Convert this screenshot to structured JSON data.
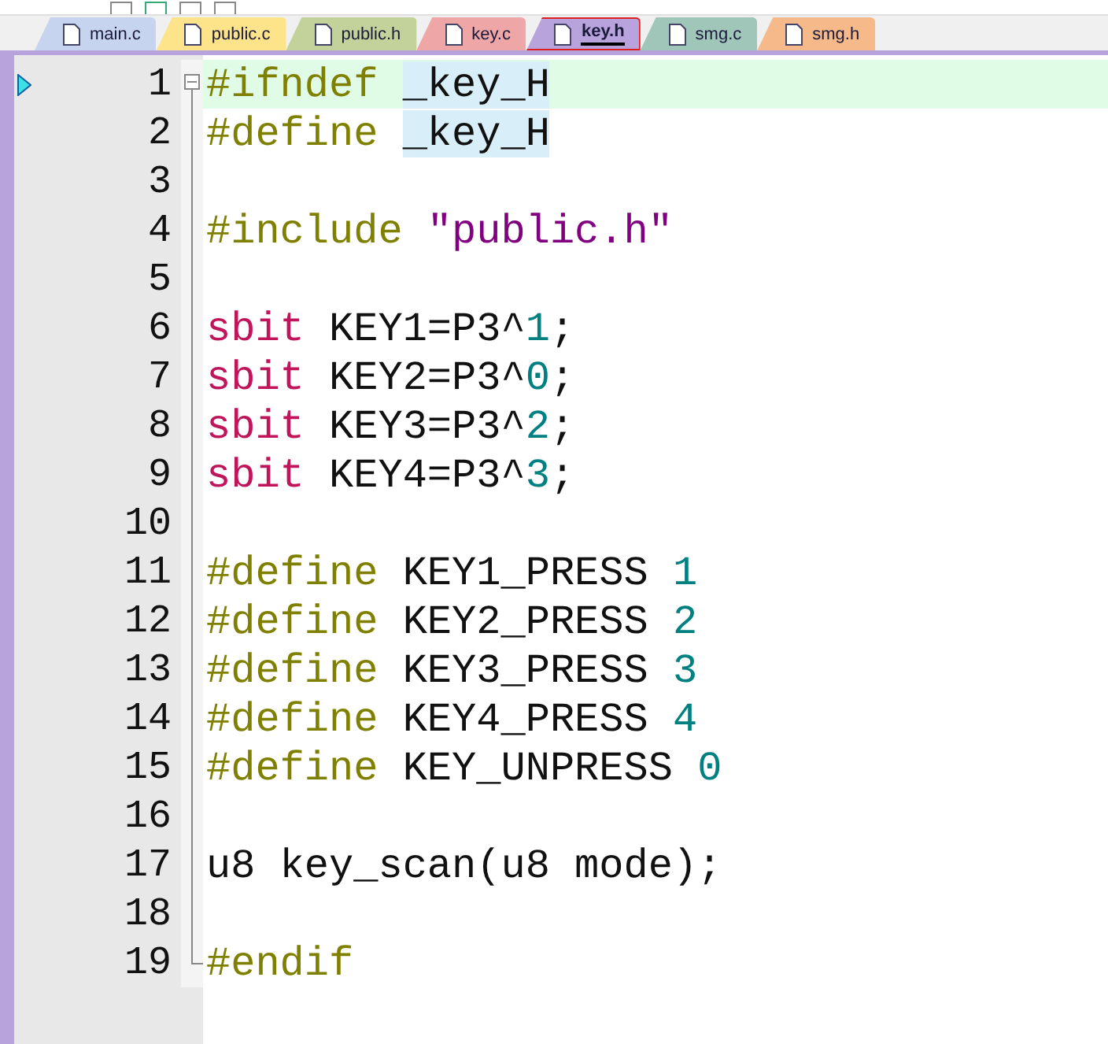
{
  "tabs": [
    {
      "label": "main.c",
      "color": "#c6d4f0",
      "selected": false
    },
    {
      "label": "public.c",
      "color": "#fde48a",
      "selected": false
    },
    {
      "label": "public.h",
      "color": "#c3d29a",
      "selected": false
    },
    {
      "label": "key.c",
      "color": "#eea6a6",
      "selected": false
    },
    {
      "label": "key.h",
      "color": "#b9a3dc",
      "selected": true
    },
    {
      "label": "smg.c",
      "color": "#9fc6b8",
      "selected": false
    },
    {
      "label": "smg.h",
      "color": "#f6b98a",
      "selected": false
    }
  ],
  "lines": [
    {
      "number": "1",
      "current": true,
      "marker": true,
      "fold_start": true,
      "tokens": [
        {
          "kind": "preproc",
          "text": "#ifndef "
        },
        {
          "kind": "ident",
          "text": "_key_H",
          "highlight": true
        }
      ]
    },
    {
      "number": "2",
      "tokens": [
        {
          "kind": "preproc",
          "text": "#define "
        },
        {
          "kind": "ident",
          "text": "_key_H",
          "highlight": true
        }
      ]
    },
    {
      "number": "3"
    },
    {
      "number": "4",
      "tokens": [
        {
          "kind": "preproc",
          "text": "#include "
        },
        {
          "kind": "string",
          "text": "\"public.h\""
        }
      ]
    },
    {
      "number": "5"
    },
    {
      "number": "6",
      "tokens": [
        {
          "kind": "keyword",
          "text": "sbit "
        },
        {
          "kind": "ident",
          "text": "KEY1=P3^"
        },
        {
          "kind": "number",
          "text": "1"
        },
        {
          "kind": "ident",
          "text": ";"
        }
      ]
    },
    {
      "number": "7",
      "tokens": [
        {
          "kind": "keyword",
          "text": "sbit "
        },
        {
          "kind": "ident",
          "text": "KEY2=P3^"
        },
        {
          "kind": "number",
          "text": "0"
        },
        {
          "kind": "ident",
          "text": ";"
        }
      ]
    },
    {
      "number": "8",
      "tokens": [
        {
          "kind": "keyword",
          "text": "sbit "
        },
        {
          "kind": "ident",
          "text": "KEY3=P3^"
        },
        {
          "kind": "number",
          "text": "2"
        },
        {
          "kind": "ident",
          "text": ";"
        }
      ]
    },
    {
      "number": "9",
      "tokens": [
        {
          "kind": "keyword",
          "text": "sbit "
        },
        {
          "kind": "ident",
          "text": "KEY4=P3^"
        },
        {
          "kind": "number",
          "text": "3"
        },
        {
          "kind": "ident",
          "text": ";"
        }
      ]
    },
    {
      "number": "10"
    },
    {
      "number": "11",
      "tokens": [
        {
          "kind": "preproc",
          "text": "#define "
        },
        {
          "kind": "ident",
          "text": "KEY1_PRESS "
        },
        {
          "kind": "number",
          "text": "1"
        }
      ]
    },
    {
      "number": "12",
      "tokens": [
        {
          "kind": "preproc",
          "text": "#define "
        },
        {
          "kind": "ident",
          "text": "KEY2_PRESS "
        },
        {
          "kind": "number",
          "text": "2"
        }
      ]
    },
    {
      "number": "13",
      "tokens": [
        {
          "kind": "preproc",
          "text": "#define "
        },
        {
          "kind": "ident",
          "text": "KEY3_PRESS "
        },
        {
          "kind": "number",
          "text": "3"
        }
      ]
    },
    {
      "number": "14",
      "tokens": [
        {
          "kind": "preproc",
          "text": "#define "
        },
        {
          "kind": "ident",
          "text": "KEY4_PRESS "
        },
        {
          "kind": "number",
          "text": "4"
        }
      ]
    },
    {
      "number": "15",
      "tokens": [
        {
          "kind": "preproc",
          "text": "#define "
        },
        {
          "kind": "ident",
          "text": "KEY_UNPRESS "
        },
        {
          "kind": "number",
          "text": "0"
        }
      ]
    },
    {
      "number": "16"
    },
    {
      "number": "17",
      "tokens": [
        {
          "kind": "ident",
          "text": "u8 key_scan(u8 mode);"
        }
      ]
    },
    {
      "number": "18"
    },
    {
      "number": "19",
      "fold_end": true,
      "tokens": [
        {
          "kind": "preproc",
          "text": "#endif"
        }
      ]
    }
  ]
}
